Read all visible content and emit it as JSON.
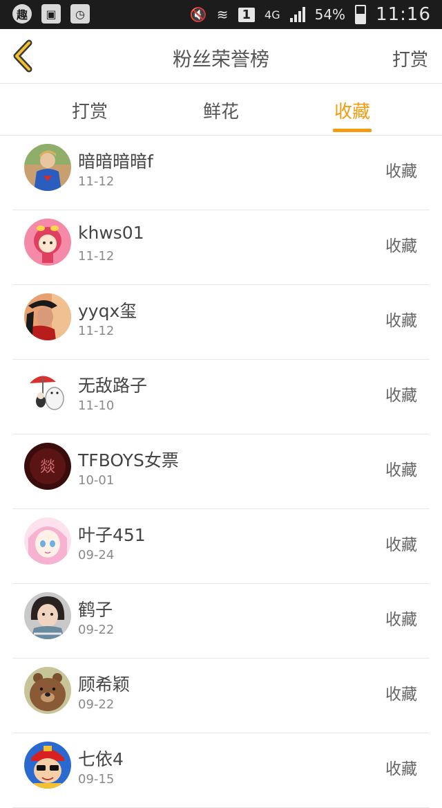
{
  "statusbar": {
    "app_badge": "趣",
    "net": "4G",
    "sim": "1",
    "battery": "54%",
    "battery_fill": 0.54,
    "time": "11:16"
  },
  "header": {
    "title": "粉丝荣誉榜",
    "right_action": "打赏"
  },
  "tabs": [
    {
      "label": "打赏",
      "active": false
    },
    {
      "label": "鲜花",
      "active": false
    },
    {
      "label": "收藏",
      "active": true
    }
  ],
  "accent_color": "#f39c12",
  "list": [
    {
      "name": "暗暗暗暗f",
      "date": "11-12",
      "action": "收藏",
      "avatar": "boy-superman-photo"
    },
    {
      "name": "khws01",
      "date": "11-12",
      "action": "收藏",
      "avatar": "cartoon-girl-red-hood"
    },
    {
      "name": "yyqx玺",
      "date": "11-12",
      "action": "收藏",
      "avatar": "boy-cap-photo"
    },
    {
      "name": "无敌路子",
      "date": "11-10",
      "action": "收藏",
      "avatar": "cartoon-umbrella"
    },
    {
      "name": "TFBOYS女票",
      "date": "10-01",
      "action": "收藏",
      "avatar": "dark-red-logo"
    },
    {
      "name": "叶子451",
      "date": "09-24",
      "action": "收藏",
      "avatar": "anime-girl-pink"
    },
    {
      "name": "鹤子",
      "date": "09-22",
      "action": "收藏",
      "avatar": "child-photo"
    },
    {
      "name": "顾希颖",
      "date": "09-22",
      "action": "收藏",
      "avatar": "cartoon-bear"
    },
    {
      "name": "七依4",
      "date": "09-15",
      "action": "收藏",
      "avatar": "cartoon-kid-red-hat"
    }
  ]
}
